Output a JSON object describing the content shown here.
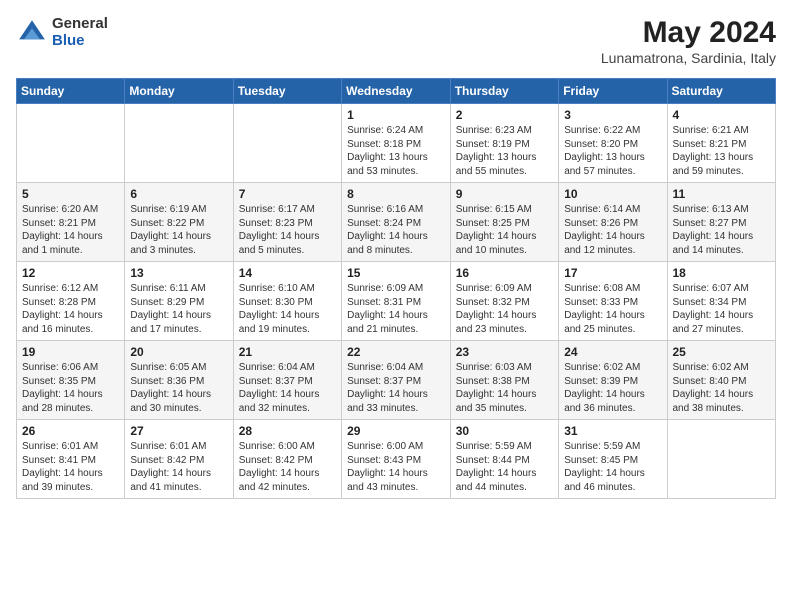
{
  "logo": {
    "general": "General",
    "blue": "Blue"
  },
  "header": {
    "month_year": "May 2024",
    "location": "Lunamatrona, Sardinia, Italy"
  },
  "weekdays": [
    "Sunday",
    "Monday",
    "Tuesday",
    "Wednesday",
    "Thursday",
    "Friday",
    "Saturday"
  ],
  "weeks": [
    [
      {
        "day": "",
        "info": ""
      },
      {
        "day": "",
        "info": ""
      },
      {
        "day": "",
        "info": ""
      },
      {
        "day": "1",
        "info": "Sunrise: 6:24 AM\nSunset: 8:18 PM\nDaylight: 13 hours\nand 53 minutes."
      },
      {
        "day": "2",
        "info": "Sunrise: 6:23 AM\nSunset: 8:19 PM\nDaylight: 13 hours\nand 55 minutes."
      },
      {
        "day": "3",
        "info": "Sunrise: 6:22 AM\nSunset: 8:20 PM\nDaylight: 13 hours\nand 57 minutes."
      },
      {
        "day": "4",
        "info": "Sunrise: 6:21 AM\nSunset: 8:21 PM\nDaylight: 13 hours\nand 59 minutes."
      }
    ],
    [
      {
        "day": "5",
        "info": "Sunrise: 6:20 AM\nSunset: 8:21 PM\nDaylight: 14 hours\nand 1 minute."
      },
      {
        "day": "6",
        "info": "Sunrise: 6:19 AM\nSunset: 8:22 PM\nDaylight: 14 hours\nand 3 minutes."
      },
      {
        "day": "7",
        "info": "Sunrise: 6:17 AM\nSunset: 8:23 PM\nDaylight: 14 hours\nand 5 minutes."
      },
      {
        "day": "8",
        "info": "Sunrise: 6:16 AM\nSunset: 8:24 PM\nDaylight: 14 hours\nand 8 minutes."
      },
      {
        "day": "9",
        "info": "Sunrise: 6:15 AM\nSunset: 8:25 PM\nDaylight: 14 hours\nand 10 minutes."
      },
      {
        "day": "10",
        "info": "Sunrise: 6:14 AM\nSunset: 8:26 PM\nDaylight: 14 hours\nand 12 minutes."
      },
      {
        "day": "11",
        "info": "Sunrise: 6:13 AM\nSunset: 8:27 PM\nDaylight: 14 hours\nand 14 minutes."
      }
    ],
    [
      {
        "day": "12",
        "info": "Sunrise: 6:12 AM\nSunset: 8:28 PM\nDaylight: 14 hours\nand 16 minutes."
      },
      {
        "day": "13",
        "info": "Sunrise: 6:11 AM\nSunset: 8:29 PM\nDaylight: 14 hours\nand 17 minutes."
      },
      {
        "day": "14",
        "info": "Sunrise: 6:10 AM\nSunset: 8:30 PM\nDaylight: 14 hours\nand 19 minutes."
      },
      {
        "day": "15",
        "info": "Sunrise: 6:09 AM\nSunset: 8:31 PM\nDaylight: 14 hours\nand 21 minutes."
      },
      {
        "day": "16",
        "info": "Sunrise: 6:09 AM\nSunset: 8:32 PM\nDaylight: 14 hours\nand 23 minutes."
      },
      {
        "day": "17",
        "info": "Sunrise: 6:08 AM\nSunset: 8:33 PM\nDaylight: 14 hours\nand 25 minutes."
      },
      {
        "day": "18",
        "info": "Sunrise: 6:07 AM\nSunset: 8:34 PM\nDaylight: 14 hours\nand 27 minutes."
      }
    ],
    [
      {
        "day": "19",
        "info": "Sunrise: 6:06 AM\nSunset: 8:35 PM\nDaylight: 14 hours\nand 28 minutes."
      },
      {
        "day": "20",
        "info": "Sunrise: 6:05 AM\nSunset: 8:36 PM\nDaylight: 14 hours\nand 30 minutes."
      },
      {
        "day": "21",
        "info": "Sunrise: 6:04 AM\nSunset: 8:37 PM\nDaylight: 14 hours\nand 32 minutes."
      },
      {
        "day": "22",
        "info": "Sunrise: 6:04 AM\nSunset: 8:37 PM\nDaylight: 14 hours\nand 33 minutes."
      },
      {
        "day": "23",
        "info": "Sunrise: 6:03 AM\nSunset: 8:38 PM\nDaylight: 14 hours\nand 35 minutes."
      },
      {
        "day": "24",
        "info": "Sunrise: 6:02 AM\nSunset: 8:39 PM\nDaylight: 14 hours\nand 36 minutes."
      },
      {
        "day": "25",
        "info": "Sunrise: 6:02 AM\nSunset: 8:40 PM\nDaylight: 14 hours\nand 38 minutes."
      }
    ],
    [
      {
        "day": "26",
        "info": "Sunrise: 6:01 AM\nSunset: 8:41 PM\nDaylight: 14 hours\nand 39 minutes."
      },
      {
        "day": "27",
        "info": "Sunrise: 6:01 AM\nSunset: 8:42 PM\nDaylight: 14 hours\nand 41 minutes."
      },
      {
        "day": "28",
        "info": "Sunrise: 6:00 AM\nSunset: 8:42 PM\nDaylight: 14 hours\nand 42 minutes."
      },
      {
        "day": "29",
        "info": "Sunrise: 6:00 AM\nSunset: 8:43 PM\nDaylight: 14 hours\nand 43 minutes."
      },
      {
        "day": "30",
        "info": "Sunrise: 5:59 AM\nSunset: 8:44 PM\nDaylight: 14 hours\nand 44 minutes."
      },
      {
        "day": "31",
        "info": "Sunrise: 5:59 AM\nSunset: 8:45 PM\nDaylight: 14 hours\nand 46 minutes."
      },
      {
        "day": "",
        "info": ""
      }
    ]
  ]
}
